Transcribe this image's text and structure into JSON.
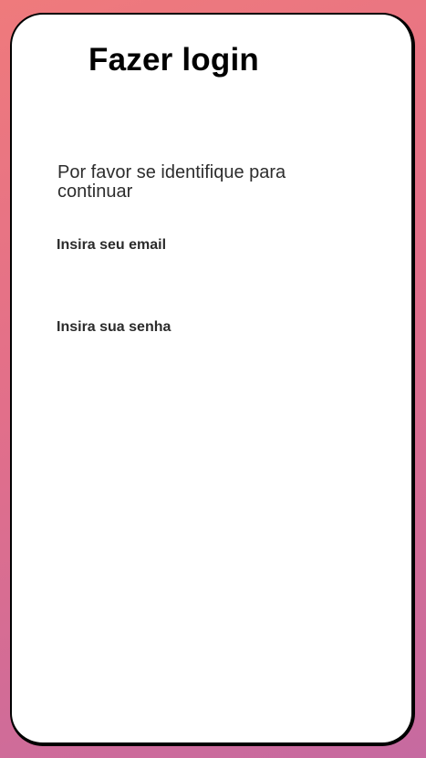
{
  "login": {
    "title": "Fazer login",
    "subtitle": "Por favor se identifique para continuar",
    "email_label": "Insira seu email",
    "email_value": "",
    "password_label": "Insira sua senha",
    "password_value": ""
  },
  "colors": {
    "background_gradient_top": "#ef7a7c",
    "background_gradient_bottom": "#c66aa0",
    "card_background": "#ffffff",
    "card_border": "#000000"
  }
}
